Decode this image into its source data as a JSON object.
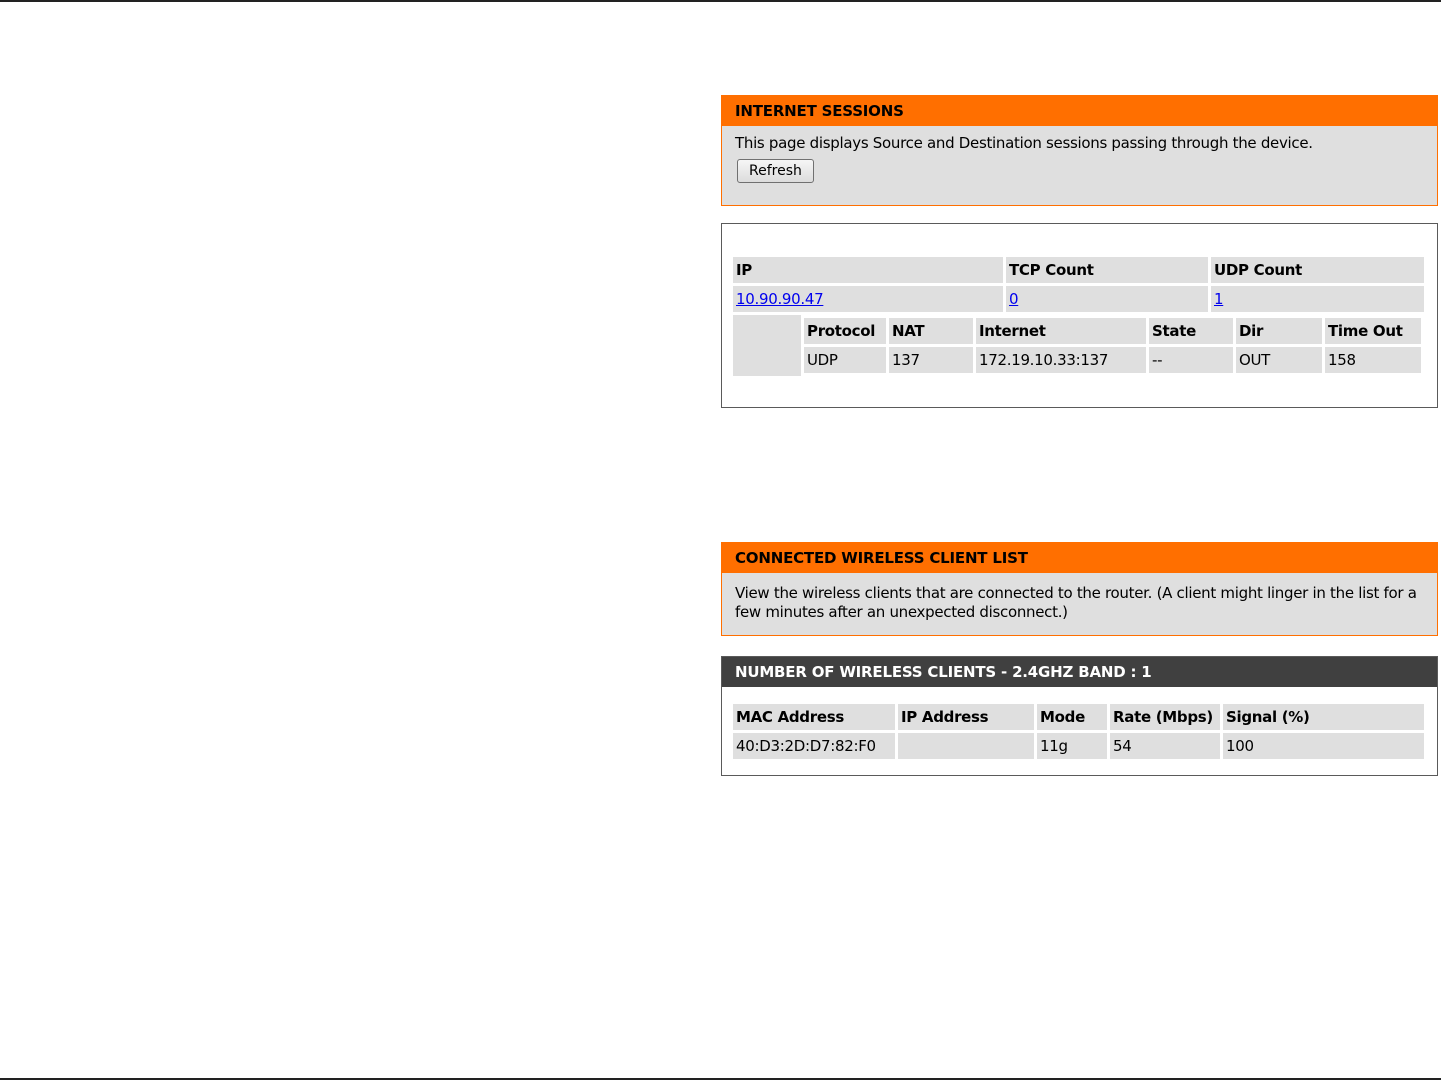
{
  "sessions_panel": {
    "title": "INTERNET SESSIONS",
    "description": "This page displays Source and Destination sessions passing through the device.",
    "refresh_label": "Refresh"
  },
  "sessions_table": {
    "headers": {
      "ip": "IP",
      "tcp": "TCP Count",
      "udp": "UDP Count"
    },
    "row": {
      "ip": "10.90.90.47",
      "tcp": "0",
      "udp": "1"
    },
    "detail_headers": {
      "protocol": "Protocol",
      "nat": "NAT",
      "internet": "Internet",
      "state": "State",
      "dir": "Dir",
      "timeout": "Time Out"
    },
    "detail_row": {
      "protocol": "UDP",
      "nat": "137",
      "internet": "172.19.10.33:137",
      "state": "--",
      "dir": "OUT",
      "timeout": "158"
    }
  },
  "wireless_panel": {
    "title": "CONNECTED WIRELESS CLIENT LIST",
    "description": "View the wireless clients that are connected to the router. (A client might linger in the list for a few minutes after an unexpected disconnect.)"
  },
  "wireless_clients": {
    "title": "NUMBER OF WIRELESS CLIENTS - 2.4GHZ BAND : 1",
    "headers": {
      "mac": "MAC Address",
      "ip": "IP Address",
      "mode": "Mode",
      "rate": "Rate (Mbps)",
      "signal": "Signal (%)"
    },
    "row": {
      "mac": "40:D3:2D:D7:82:F0",
      "ip": "",
      "mode": "11g",
      "rate": "54",
      "signal": "100"
    }
  },
  "colors": {
    "accent_orange": "#ff6f00",
    "dark_header": "#404040",
    "cell_gray": "#dfdfdf",
    "link_blue": "#0000ee"
  }
}
